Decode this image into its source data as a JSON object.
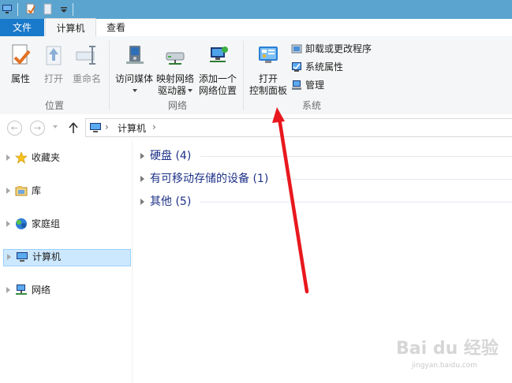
{
  "ribbon_tabs": {
    "file": "文件",
    "computer": "计算机",
    "view": "查看"
  },
  "location_group": {
    "label": "位置",
    "properties": "属性",
    "open": "打开",
    "rename": "重命名"
  },
  "network_group": {
    "label": "网络",
    "access_media_line1": "访问媒体",
    "map_drive_line1": "映射网络",
    "map_drive_line2": "驱动器",
    "add_location_line1": "添加一个",
    "add_location_line2": "网络位置"
  },
  "system_group": {
    "label": "系统",
    "open_cp_line1": "打开",
    "open_cp_line2": "控制面板",
    "uninstall": "卸载或更改程序",
    "system_properties": "系统属性",
    "manage": "管理"
  },
  "address_bar": {
    "path_segment": "计算机",
    "separator": "›"
  },
  "nav_pane": {
    "items": [
      {
        "label": "收藏夹",
        "icon": "star-icon"
      },
      {
        "label": "库",
        "icon": "library-icon"
      },
      {
        "label": "家庭组",
        "icon": "homegroup-icon"
      },
      {
        "label": "计算机",
        "icon": "computer-icon",
        "selected": true
      },
      {
        "label": "网络",
        "icon": "network-icon"
      }
    ]
  },
  "content_groups": [
    {
      "label": "硬盘 (4)"
    },
    {
      "label": "有可移动存储的设备 (1)"
    },
    {
      "label": "其他 (5)"
    }
  ],
  "watermark": {
    "brand": "Bai du 经验",
    "url": "jingyan.baidu.com"
  },
  "colors": {
    "title_bar": "#5ba4d0",
    "file_tab": "#1979ca",
    "ribbon_bg": "#f5f6f7",
    "group_heading": "#1e3287",
    "selection": "#cce8ff",
    "annotation_arrow": "#e8181e"
  }
}
